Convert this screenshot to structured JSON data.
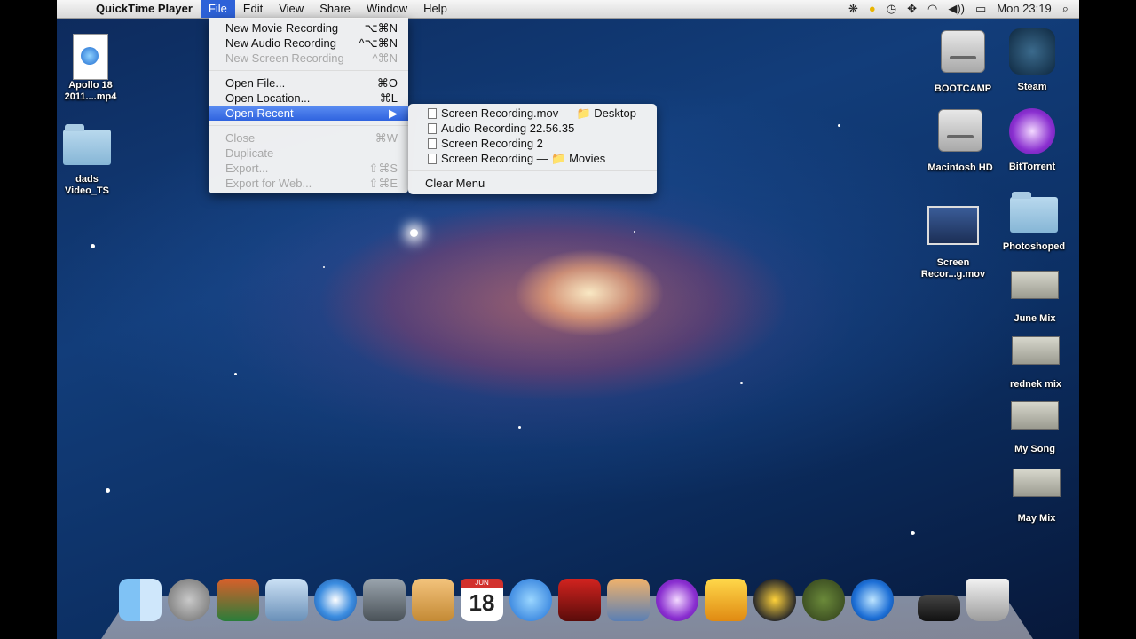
{
  "menubar": {
    "app_name": "QuickTime Player",
    "items": [
      "File",
      "Edit",
      "View",
      "Window",
      "Share",
      "Window",
      "Help"
    ],
    "active": "File",
    "clock": "Mon 23:19"
  },
  "file_menu": {
    "items": [
      {
        "label": "New Movie Recording",
        "shortcut": "⌥⌘N",
        "disabled": false
      },
      {
        "label": "New Audio Recording",
        "shortcut": "^⌥⌘N",
        "disabled": false
      },
      {
        "label": "New Screen Recording",
        "shortcut": "^⌘N",
        "disabled": true
      },
      {
        "label": "Open File...",
        "shortcut": "⌘O",
        "disabled": false
      },
      {
        "label": "Open Location...",
        "shortcut": "⌘L",
        "disabled": false
      },
      {
        "label": "Open Recent",
        "shortcut": "▶",
        "disabled": false,
        "highlighted": true
      },
      {
        "label": "Close",
        "shortcut": "⌘W",
        "disabled": true
      },
      {
        "label": "Duplicate",
        "shortcut": "",
        "disabled": true
      },
      {
        "label": "Export...",
        "shortcut": "⇧⌘S",
        "disabled": true
      },
      {
        "label": "Export for Web...",
        "shortcut": "⇧⌘E",
        "disabled": true
      }
    ]
  },
  "open_recent": {
    "items": [
      "Screen Recording.mov — 📁 Desktop",
      "Audio Recording 22.56.35",
      "Screen Recording 2",
      "Screen Recording — 📁 Movies"
    ],
    "clear": "Clear Menu"
  },
  "desktop_left": [
    {
      "label": "Apollo 18\n2011....mp4",
      "icon": "mpeg-file-icon"
    },
    {
      "label": "dads\nVideo_TS",
      "icon": "folder-icon"
    }
  ],
  "desktop_right": [
    {
      "label": "BOOTCAMP",
      "icon": "hard-drive-icon"
    },
    {
      "label": "Steam",
      "icon": "steam-icon"
    },
    {
      "label": "Macintosh HD",
      "icon": "hard-drive-icon"
    },
    {
      "label": "BitTorrent",
      "icon": "bittorrent-icon"
    },
    {
      "label": "Screen\nRecor...g.mov",
      "icon": "screen-recording-icon"
    },
    {
      "label": "Photoshoped",
      "icon": "folder-icon"
    },
    {
      "label": "June Mix",
      "icon": "audio-box-icon"
    },
    {
      "label": "rednek mix",
      "icon": "audio-box-icon"
    },
    {
      "label": "My Song",
      "icon": "audio-box-icon"
    },
    {
      "label": "May Mix",
      "icon": "audio-box-icon"
    }
  ],
  "dock": {
    "apps": [
      "finder",
      "launchpad",
      "photo-booth",
      "mail",
      "safari",
      "facetime",
      "address-book",
      "ical",
      "itunes",
      "photobooth",
      "iphoto",
      "bittorrent",
      "garageband",
      "vlc",
      "world-globe",
      "quicktime",
      "terminal",
      "trash"
    ],
    "ical_day": "18",
    "ical_month": "JUN"
  },
  "colors": {
    "menu_highlight": "#2f63df",
    "menubar": "#e6e6e6"
  }
}
